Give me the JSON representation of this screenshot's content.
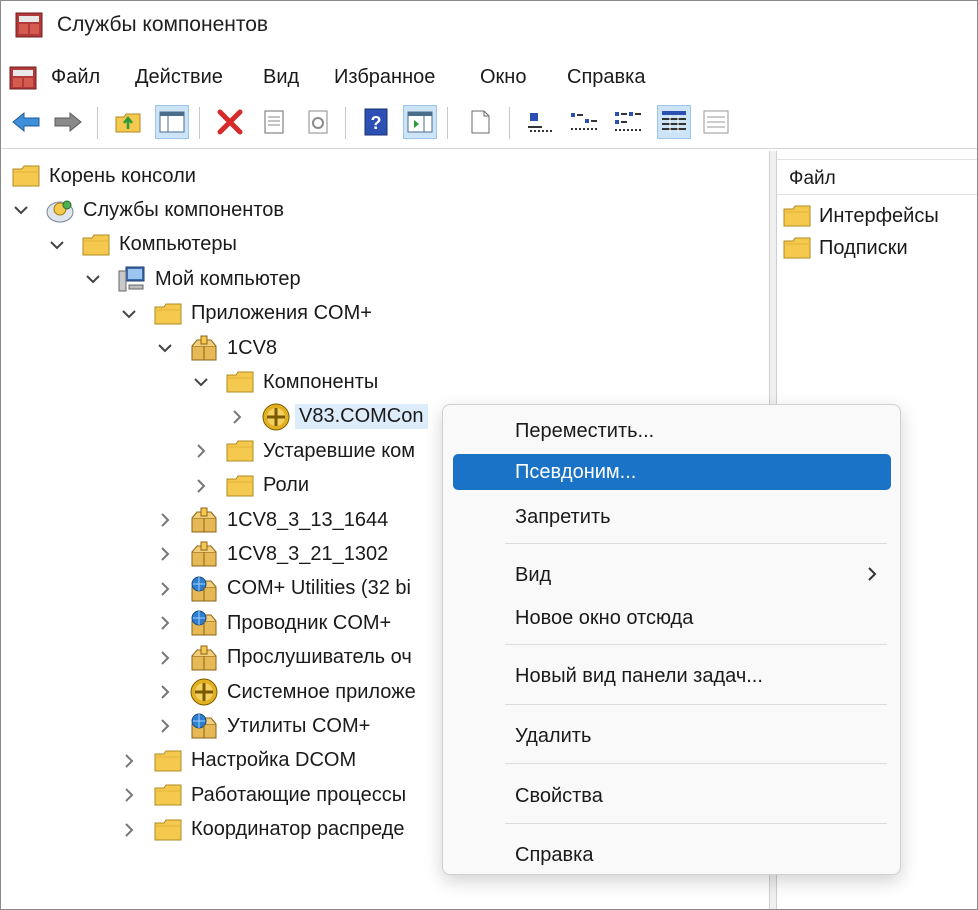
{
  "window": {
    "title": "Службы компонентов"
  },
  "menubar": {
    "items": [
      "Файл",
      "Действие",
      "Вид",
      "Избранное",
      "Окно",
      "Справка"
    ]
  },
  "toolbar": {
    "buttons": [
      "back-arrow-icon",
      "forward-arrow-icon",
      "up-folder-icon",
      "show-hide-tree-icon",
      "delete-icon",
      "properties-icon",
      "refresh-icon",
      "help-icon",
      "action-pane-icon",
      "new-item-icon",
      "large-icons-view-icon",
      "small-icons-view-icon",
      "list-view-icon",
      "details-view-icon",
      "status-view-icon"
    ]
  },
  "tree": {
    "nodes": [
      {
        "label": "Корень консоли",
        "depth": 0,
        "chevron": "none",
        "icon": "folder"
      },
      {
        "label": "Службы компонентов",
        "depth": 0,
        "chevron": "down",
        "icon": "component-services"
      },
      {
        "label": "Компьютеры",
        "depth": 1,
        "chevron": "down",
        "icon": "folder"
      },
      {
        "label": "Мой компьютер",
        "depth": 2,
        "chevron": "down",
        "icon": "computer"
      },
      {
        "label": "Приложения COM+",
        "depth": 3,
        "chevron": "down",
        "icon": "folder"
      },
      {
        "label": "1CV8",
        "depth": 4,
        "chevron": "down",
        "icon": "package"
      },
      {
        "label": "Компоненты",
        "depth": 5,
        "chevron": "down",
        "icon": "folder"
      },
      {
        "label": "V83.COMCon",
        "depth": 6,
        "chevron": "right",
        "icon": "component",
        "selected": true
      },
      {
        "label": "Устаревшие ком",
        "depth": 5,
        "chevron": "right",
        "icon": "folder"
      },
      {
        "label": "Роли",
        "depth": 5,
        "chevron": "right",
        "icon": "folder"
      },
      {
        "label": "1CV8_3_13_1644",
        "depth": 4,
        "chevron": "right",
        "icon": "package"
      },
      {
        "label": "1CV8_3_21_1302",
        "depth": 4,
        "chevron": "right",
        "icon": "package"
      },
      {
        "label": "COM+ Utilities (32 bi",
        "depth": 4,
        "chevron": "right",
        "icon": "package-globe"
      },
      {
        "label": "Проводник COM+",
        "depth": 4,
        "chevron": "right",
        "icon": "package-globe"
      },
      {
        "label": "Прослушиватель оч",
        "depth": 4,
        "chevron": "right",
        "icon": "package"
      },
      {
        "label": "Системное приложе",
        "depth": 4,
        "chevron": "right",
        "icon": "component"
      },
      {
        "label": "Утилиты COM+",
        "depth": 4,
        "chevron": "right",
        "icon": "package-globe"
      },
      {
        "label": "Настройка DCOM",
        "depth": 3,
        "chevron": "right",
        "icon": "folder"
      },
      {
        "label": "Работающие процессы",
        "depth": 3,
        "chevron": "right",
        "icon": "folder"
      },
      {
        "label": "Координатор распреде",
        "depth": 3,
        "chevron": "right",
        "icon": "folder"
      }
    ]
  },
  "list": {
    "column_header": "Файл",
    "items": [
      "Интерфейсы",
      "Подписки"
    ]
  },
  "context_menu": {
    "items": [
      {
        "label": "Переместить...",
        "hover": false
      },
      {
        "label": "Псевдоним...",
        "hover": true
      },
      {
        "label": "Запретить",
        "hover": false
      },
      {
        "label": "Вид",
        "hover": false,
        "submenu": true
      },
      {
        "label": "Новое окно отсюда",
        "hover": false
      },
      {
        "label": "Новый вид панели задач...",
        "hover": false
      },
      {
        "label": "Удалить",
        "hover": false
      },
      {
        "label": "Свойства",
        "hover": false
      },
      {
        "label": "Справка",
        "hover": false
      }
    ]
  },
  "colors": {
    "menu_highlight": "#1a73c7",
    "selection": "#dcecfb",
    "folder": "#f4c94e"
  }
}
